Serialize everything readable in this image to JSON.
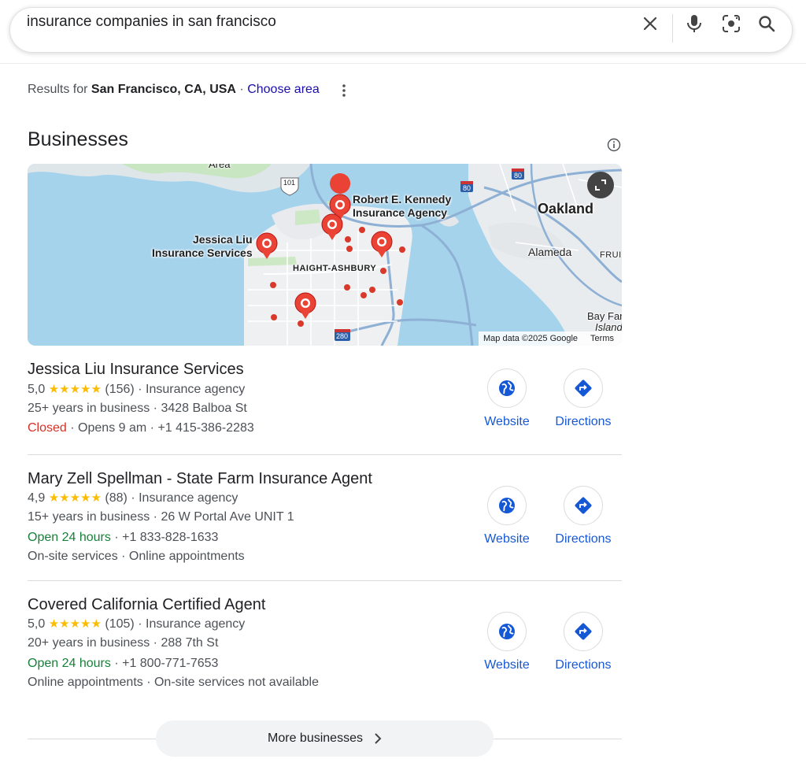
{
  "search": {
    "query": "insurance companies in san francisco"
  },
  "results_for": {
    "prefix": "Results for",
    "location": "San Francisco, CA, USA",
    "sep": "·",
    "choose_area": "Choose area"
  },
  "section_title": "Businesses",
  "map": {
    "labels": {
      "robert_1": "Robert E. Kennedy",
      "robert_2": "Insurance Agency",
      "jessica_1": "Jessica Liu",
      "jessica_2": "Insurance Services",
      "oakland": "Oakland",
      "alameda": "Alameda",
      "haight": "HAIGHT-ASHBURY",
      "bay_farm_1": "Bay Far",
      "bay_farm_2": "Island",
      "fruit": "FRUI",
      "area": "Area",
      "hwy101": "101",
      "hwy80a": "80",
      "hwy80b": "80",
      "hwy280": "280"
    },
    "footer_data": "Map data ©2025 Google",
    "footer_terms": "Terms"
  },
  "businesses": [
    {
      "name": "Jessica Liu Insurance Services",
      "rating": "5,0",
      "stars": "★★★★★",
      "reviews": "(156)",
      "category": "Insurance agency",
      "years": "25+ years in business",
      "address": "3428 Balboa St",
      "status": "Closed",
      "hours": "Opens 9 am",
      "phone": "+1 415-386-2283",
      "extra": "",
      "website": "Website",
      "directions": "Directions"
    },
    {
      "name": "Mary Zell Spellman - State Farm Insurance Agent",
      "rating": "4,9",
      "stars": "★★★★★",
      "reviews": "(88)",
      "category": "Insurance agency",
      "years": "15+ years in business",
      "address": "26 W Portal Ave UNIT 1",
      "status": "Open 24 hours",
      "hours": "",
      "phone": "+1 833-828-1633",
      "extra": "On-site services · Online appointments",
      "website": "Website",
      "directions": "Directions"
    },
    {
      "name": "Covered California Certified Agent",
      "rating": "5,0",
      "stars": "★★★★★",
      "reviews": "(105)",
      "category": "Insurance agency",
      "years": "20+ years in business",
      "address": "288 7th St",
      "status": "Open 24 hours",
      "hours": "",
      "phone": "+1 800-771-7653",
      "extra": "Online appointments · On-site services not available",
      "website": "Website",
      "directions": "Directions"
    }
  ],
  "sep": "·",
  "more_button": "More businesses",
  "colors": {
    "link": "#1a0dab",
    "action": "#1558d6",
    "closed": "#d93025",
    "open": "#188038",
    "star": "#fbbc04",
    "pin": "#ea4335"
  }
}
